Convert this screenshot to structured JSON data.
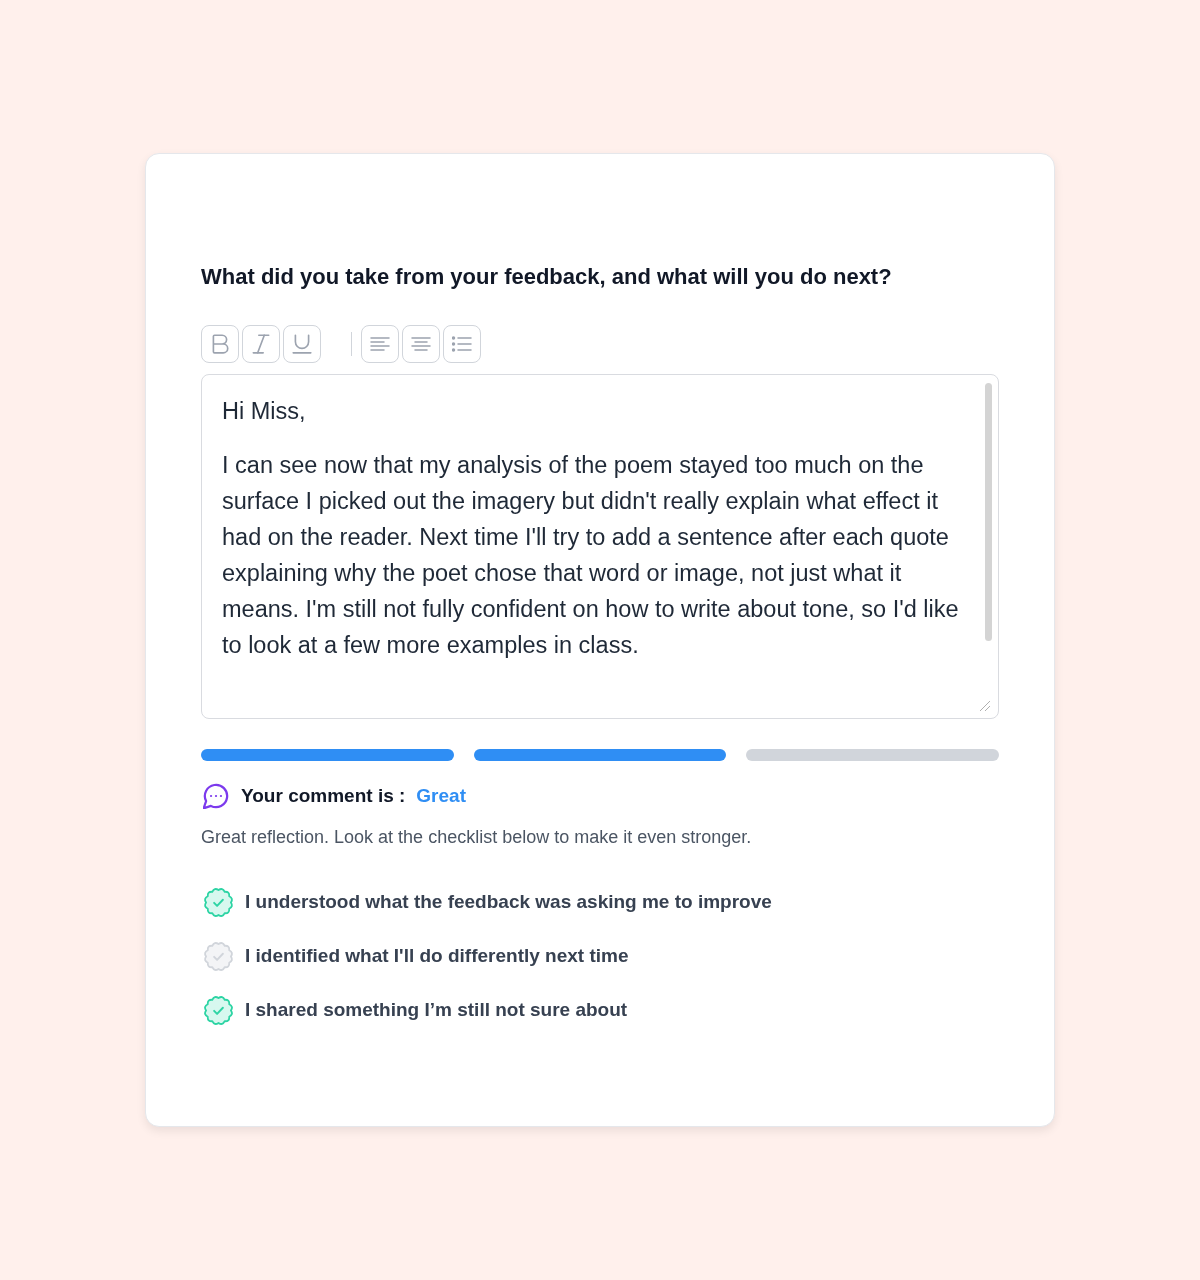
{
  "prompt": {
    "question": "What did you take from your feedback, and what will you do next?"
  },
  "toolbar": [
    {
      "kind": "bold"
    },
    {
      "kind": "italic"
    },
    {
      "kind": "underline"
    },
    {
      "kind": "divider"
    },
    {
      "kind": "left"
    },
    {
      "kind": "center"
    },
    {
      "kind": "bullets"
    }
  ],
  "editor": {
    "paragraphs": [
      "Hi Miss,",
      "I can see now that my analysis of the poem stayed too much on the surface I picked out the imagery but didn't really explain what effect it had on the reader. Next time I'll try to add a sentence after each quote explaining why the poet chose that word or image, not just what it means. I'm still not fully confident on how to write about tone, so I'd like to look at a few more examples in class."
    ]
  },
  "strength_meter": {
    "segments": [
      {
        "filled": true
      },
      {
        "filled": true
      },
      {
        "filled": false
      }
    ]
  },
  "rating": {
    "label": "Your comment is :",
    "value": "Great"
  },
  "feedback_text": "Great reflection. Look at the checklist below to make it even stronger.",
  "checklist": [
    {
      "text": "I understood what the feedback was asking me to improve",
      "checked": true
    },
    {
      "text": "I identified what I'll do differently next time",
      "checked": false
    },
    {
      "text": "I shared something I’m still not sure about",
      "checked": true
    }
  ]
}
